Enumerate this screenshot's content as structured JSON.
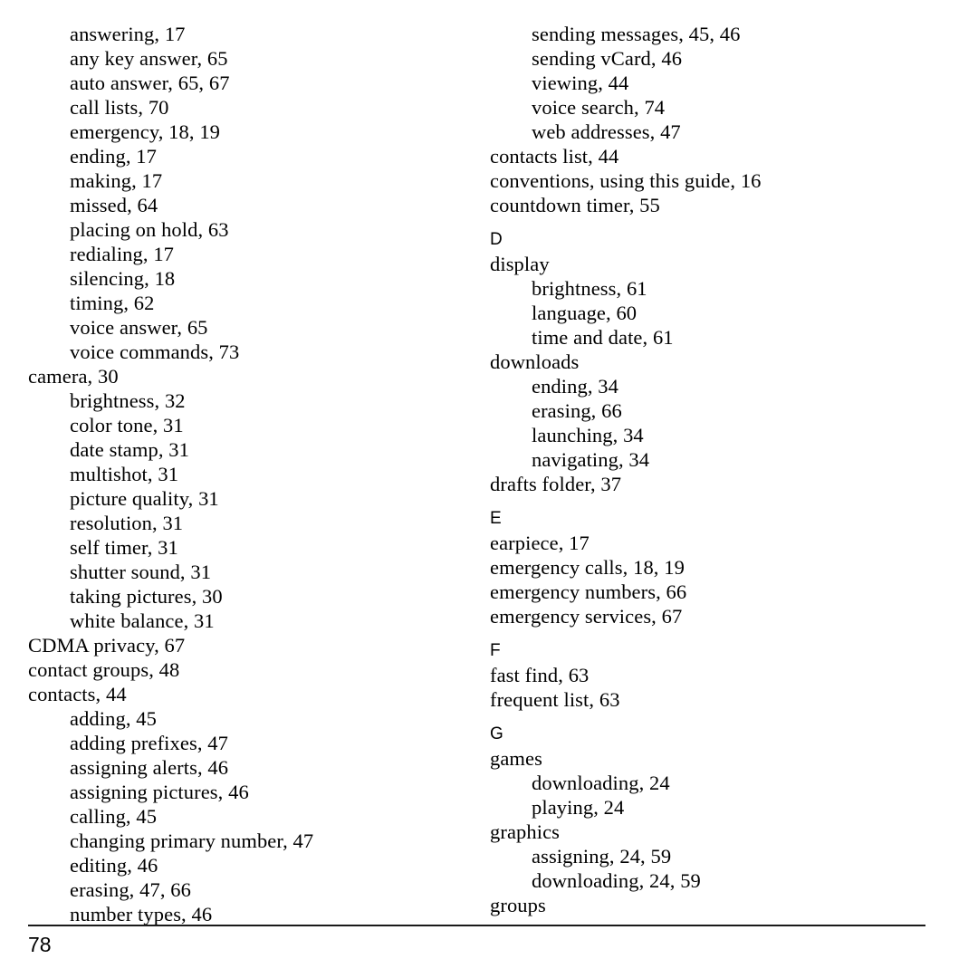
{
  "document": {
    "page_number": "78",
    "type": "index"
  },
  "columns": [
    {
      "name": "left-column",
      "blocks": [
        {
          "kind": "entry",
          "level": 1,
          "text": "answering, 17"
        },
        {
          "kind": "entry",
          "level": 1,
          "text": "any key answer, 65"
        },
        {
          "kind": "entry",
          "level": 1,
          "text": "auto answer, 65, 67"
        },
        {
          "kind": "entry",
          "level": 1,
          "text": "call lists, 70"
        },
        {
          "kind": "entry",
          "level": 1,
          "text": "emergency, 18, 19"
        },
        {
          "kind": "entry",
          "level": 1,
          "text": "ending, 17"
        },
        {
          "kind": "entry",
          "level": 1,
          "text": "making, 17"
        },
        {
          "kind": "entry",
          "level": 1,
          "text": "missed, 64"
        },
        {
          "kind": "entry",
          "level": 1,
          "text": "placing on hold, 63"
        },
        {
          "kind": "entry",
          "level": 1,
          "text": "redialing, 17"
        },
        {
          "kind": "entry",
          "level": 1,
          "text": "silencing, 18"
        },
        {
          "kind": "entry",
          "level": 1,
          "text": "timing, 62"
        },
        {
          "kind": "entry",
          "level": 1,
          "text": "voice answer, 65"
        },
        {
          "kind": "entry",
          "level": 1,
          "text": "voice commands, 73"
        },
        {
          "kind": "entry",
          "level": 0,
          "text": "camera, 30"
        },
        {
          "kind": "entry",
          "level": 1,
          "text": "brightness, 32"
        },
        {
          "kind": "entry",
          "level": 1,
          "text": "color tone, 31"
        },
        {
          "kind": "entry",
          "level": 1,
          "text": "date stamp, 31"
        },
        {
          "kind": "entry",
          "level": 1,
          "text": "multishot, 31"
        },
        {
          "kind": "entry",
          "level": 1,
          "text": "picture quality, 31"
        },
        {
          "kind": "entry",
          "level": 1,
          "text": "resolution, 31"
        },
        {
          "kind": "entry",
          "level": 1,
          "text": "self timer, 31"
        },
        {
          "kind": "entry",
          "level": 1,
          "text": "shutter sound, 31"
        },
        {
          "kind": "entry",
          "level": 1,
          "text": "taking pictures, 30"
        },
        {
          "kind": "entry",
          "level": 1,
          "text": "white balance, 31"
        },
        {
          "kind": "entry",
          "level": 0,
          "text": "CDMA privacy, 67"
        },
        {
          "kind": "entry",
          "level": 0,
          "text": "contact groups, 48"
        },
        {
          "kind": "entry",
          "level": 0,
          "text": "contacts, 44"
        },
        {
          "kind": "entry",
          "level": 1,
          "text": "adding, 45"
        },
        {
          "kind": "entry",
          "level": 1,
          "text": "adding prefixes, 47"
        },
        {
          "kind": "entry",
          "level": 1,
          "text": "assigning alerts, 46"
        },
        {
          "kind": "entry",
          "level": 1,
          "text": "assigning pictures, 46"
        },
        {
          "kind": "entry",
          "level": 1,
          "text": "calling, 45"
        },
        {
          "kind": "entry",
          "level": 1,
          "text": "changing primary number, 47"
        },
        {
          "kind": "entry",
          "level": 1,
          "text": "editing, 46"
        },
        {
          "kind": "entry",
          "level": 1,
          "text": "erasing, 47, 66"
        },
        {
          "kind": "entry",
          "level": 1,
          "text": "number types, 46"
        }
      ]
    },
    {
      "name": "right-column",
      "blocks": [
        {
          "kind": "entry",
          "level": 1,
          "text": "sending messages, 45, 46"
        },
        {
          "kind": "entry",
          "level": 1,
          "text": "sending vCard, 46"
        },
        {
          "kind": "entry",
          "level": 1,
          "text": "viewing, 44"
        },
        {
          "kind": "entry",
          "level": 1,
          "text": "voice search, 74"
        },
        {
          "kind": "entry",
          "level": 1,
          "text": "web addresses, 47"
        },
        {
          "kind": "entry",
          "level": 0,
          "text": "contacts list, 44"
        },
        {
          "kind": "entry",
          "level": 0,
          "text": "conventions, using this guide, 16"
        },
        {
          "kind": "entry",
          "level": 0,
          "text": "countdown timer, 55"
        },
        {
          "kind": "letter",
          "text": "D"
        },
        {
          "kind": "entry",
          "level": 0,
          "text": "display"
        },
        {
          "kind": "entry",
          "level": 1,
          "text": "brightness, 61"
        },
        {
          "kind": "entry",
          "level": 1,
          "text": "language, 60"
        },
        {
          "kind": "entry",
          "level": 1,
          "text": "time and date, 61"
        },
        {
          "kind": "entry",
          "level": 0,
          "text": "downloads"
        },
        {
          "kind": "entry",
          "level": 1,
          "text": "ending, 34"
        },
        {
          "kind": "entry",
          "level": 1,
          "text": "erasing, 66"
        },
        {
          "kind": "entry",
          "level": 1,
          "text": "launching, 34"
        },
        {
          "kind": "entry",
          "level": 1,
          "text": "navigating, 34"
        },
        {
          "kind": "entry",
          "level": 0,
          "text": "drafts folder, 37"
        },
        {
          "kind": "letter",
          "text": "E"
        },
        {
          "kind": "entry",
          "level": 0,
          "text": "earpiece, 17"
        },
        {
          "kind": "entry",
          "level": 0,
          "text": "emergency calls, 18, 19"
        },
        {
          "kind": "entry",
          "level": 0,
          "text": "emergency numbers, 66"
        },
        {
          "kind": "entry",
          "level": 0,
          "text": "emergency services, 67"
        },
        {
          "kind": "letter",
          "text": "F"
        },
        {
          "kind": "entry",
          "level": 0,
          "text": "fast find, 63"
        },
        {
          "kind": "entry",
          "level": 0,
          "text": "frequent list, 63"
        },
        {
          "kind": "letter",
          "text": "G"
        },
        {
          "kind": "entry",
          "level": 0,
          "text": "games"
        },
        {
          "kind": "entry",
          "level": 1,
          "text": "downloading, 24"
        },
        {
          "kind": "entry",
          "level": 1,
          "text": "playing, 24"
        },
        {
          "kind": "entry",
          "level": 0,
          "text": "graphics"
        },
        {
          "kind": "entry",
          "level": 1,
          "text": "assigning, 24, 59"
        },
        {
          "kind": "entry",
          "level": 1,
          "text": "downloading, 24, 59"
        },
        {
          "kind": "entry",
          "level": 0,
          "text": "groups"
        }
      ]
    }
  ]
}
